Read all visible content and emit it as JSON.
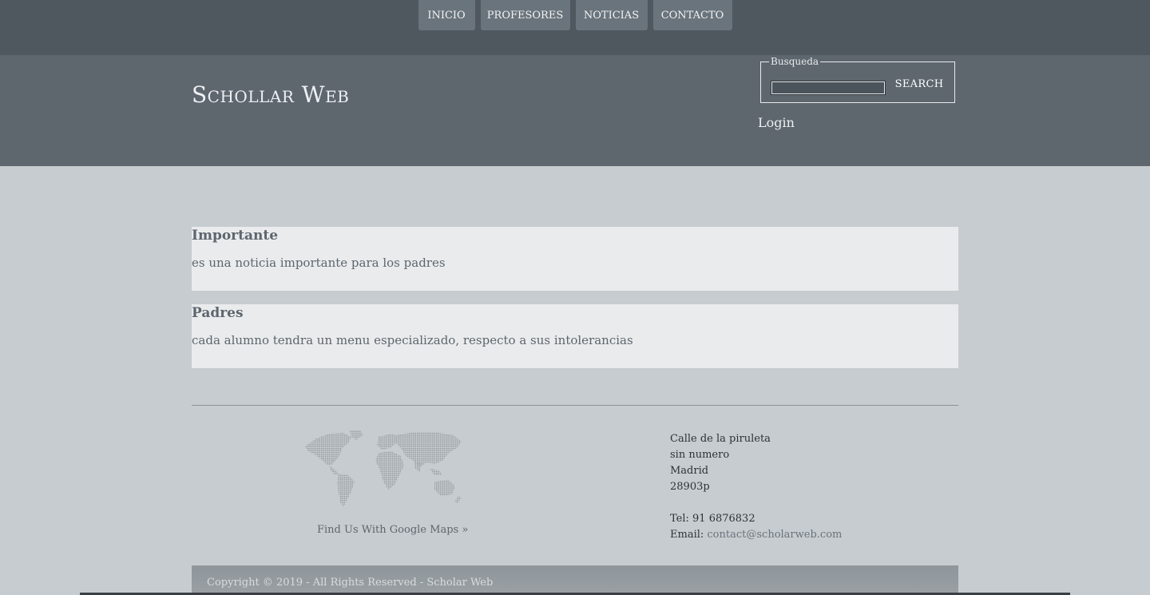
{
  "nav": {
    "items": [
      {
        "label": "INICIO"
      },
      {
        "label": "PROFESORES"
      },
      {
        "label": "NOTICIAS"
      },
      {
        "label": "CONTACTO"
      }
    ]
  },
  "header": {
    "brand": "Schollar Web",
    "search": {
      "legend": "Busqueda",
      "value": "",
      "button_label": "SEARCH"
    },
    "login_label": "Login"
  },
  "news": [
    {
      "title": "Importante",
      "body": "es una noticia importante para los padres"
    },
    {
      "title": "Padres",
      "body": "cada alumno tendra un menu especializado, respecto a sus intolerancias"
    }
  ],
  "footer": {
    "maps_link": "Find Us With Google Maps »",
    "address": {
      "line1": "Calle de la piruleta",
      "line2": "sin numero",
      "line3": "Madrid",
      "line4": "28903p",
      "tel": "Tel: 91 6876832",
      "email_label": "Email:",
      "email": "contact@scholarweb.com"
    },
    "copyright": "Copyright © 2019 - All Rights Reserved - Scholar Web"
  },
  "colors": {
    "topbar": "#4f575f",
    "header": "#5e666e",
    "nav_item": "#6a747c",
    "page_bg": "#c7ccd0",
    "card_bg": "#eaebed"
  },
  "icons": {
    "map": "world-map-icon"
  }
}
